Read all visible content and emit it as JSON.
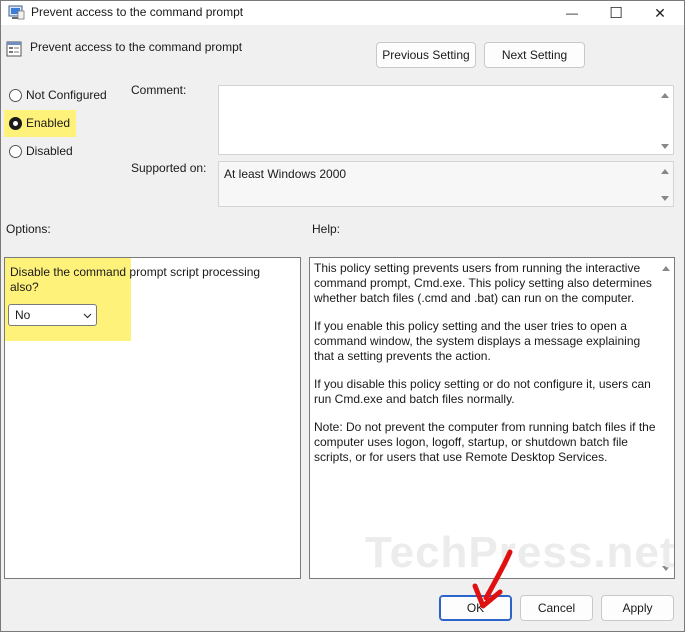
{
  "window": {
    "title": "Prevent access to the command prompt",
    "minimize_glyph": "—",
    "maximize_glyph": "☐",
    "close_glyph": "✕"
  },
  "header": {
    "policy_title": "Prevent access to the command prompt",
    "previous_setting": "Previous Setting",
    "next_setting": "Next Setting"
  },
  "state": {
    "options": [
      {
        "label": "Not Configured",
        "checked": false
      },
      {
        "label": "Enabled",
        "checked": true
      },
      {
        "label": "Disabled",
        "checked": false
      }
    ]
  },
  "comment": {
    "label": "Comment:",
    "value": ""
  },
  "supported": {
    "label": "Supported on:",
    "value": "At least Windows 2000"
  },
  "options_section": {
    "label": "Options:",
    "question": "Disable the command prompt script processing also?",
    "dropdown_value": "No"
  },
  "help_section": {
    "label": "Help:",
    "paragraphs": [
      "This policy setting prevents users from running the interactive command prompt, Cmd.exe.  This policy setting also determines whether batch files (.cmd and .bat) can run on the computer.",
      "If you enable this policy setting and the user tries to open a command window, the system displays a message explaining that a setting prevents the action.",
      "If you disable this policy setting or do not configure it, users can run Cmd.exe and batch files normally.",
      "Note: Do not prevent the computer from running batch files if the computer uses logon, logoff, startup, or shutdown batch file scripts, or for users that use Remote Desktop Services."
    ]
  },
  "footer": {
    "ok": "OK",
    "cancel": "Cancel",
    "apply": "Apply"
  },
  "watermark": "TechPress.net",
  "colors": {
    "highlight": "#fff27a",
    "annotation_arrow": "#e01010",
    "primary_border": "#2b63c9"
  }
}
